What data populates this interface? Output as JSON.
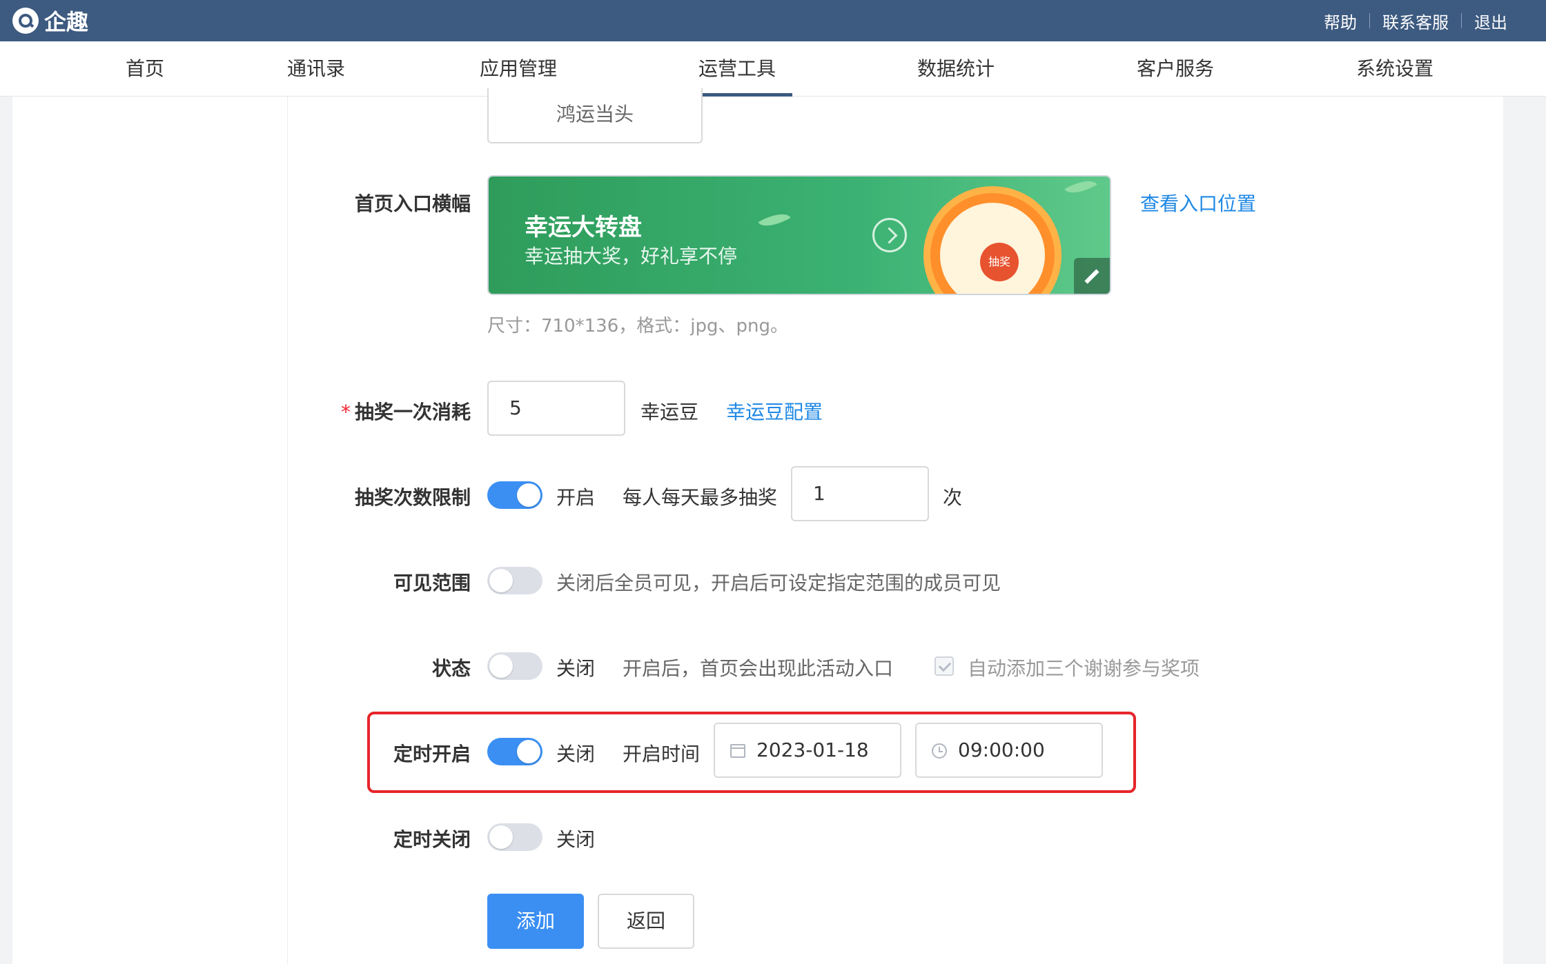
{
  "app": {
    "name": "企趣"
  },
  "topbar": {
    "links": [
      "帮助",
      "联系客服",
      "退出"
    ]
  },
  "nav": {
    "items": [
      "首页",
      "通讯录",
      "应用管理",
      "运营工具",
      "数据统计",
      "客户服务",
      "系统设置"
    ],
    "active": "运营工具"
  },
  "form": {
    "title_value": "鸿运当头",
    "banner": {
      "label": "首页入口横幅",
      "title": "幸运大转盘",
      "subtitle": "幸运抽大奖，好礼享不停",
      "wheel_center": "抽奖",
      "view_link": "查看入口位置",
      "hint": "尺寸：710*136，格式：jpg、png。"
    },
    "cost": {
      "label": "抽奖一次消耗",
      "required_mark": "*",
      "value": "5",
      "unit": "幸运豆",
      "config_link": "幸运豆配置"
    },
    "limit": {
      "label": "抽奖次数限制",
      "enabled": true,
      "state_text": "开启",
      "per_day_label": "每人每天最多抽奖",
      "value": "1",
      "unit": "次"
    },
    "visibility": {
      "label": "可见范围",
      "enabled": false,
      "desc": "关闭后全员可见，开启后可设定指定范围的成员可见"
    },
    "status": {
      "label": "状态",
      "enabled": false,
      "state_text": "关闭",
      "desc": "开启后，首页会出现此活动入口",
      "checkbox_label": "自动添加三个谢谢参与奖项",
      "checkbox_checked": true
    },
    "timed_open": {
      "label": "定时开启",
      "enabled": true,
      "state_text": "关闭",
      "time_label": "开启时间",
      "date": "2023-01-18",
      "time": "09:00:00"
    },
    "timed_close": {
      "label": "定时关闭",
      "enabled": false,
      "state_text": "关闭"
    },
    "buttons": {
      "add": "添加",
      "back": "返回"
    }
  },
  "colors": {
    "topbar": "#3d5a80",
    "primary": "#3b8ff3",
    "link": "#1e88e5",
    "highlight": "#e5262b",
    "banner": "#3bb273"
  }
}
